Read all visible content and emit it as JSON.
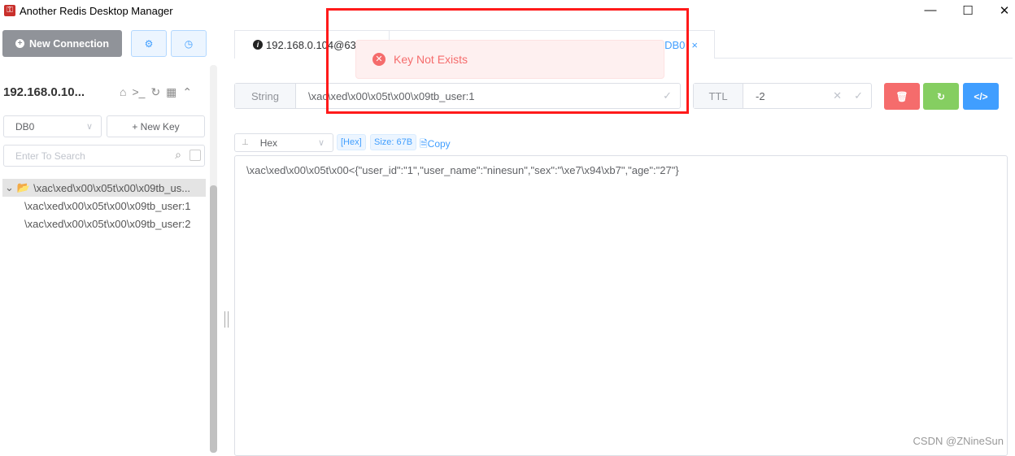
{
  "window": {
    "title": "Another Redis Desktop Manager",
    "controls": {
      "minimize": "—",
      "maximize": "☐",
      "close": "✕"
    }
  },
  "sidebar": {
    "new_connection_label": "New Connection",
    "connection_name": "192.168.0.10...",
    "db_select": "DB0",
    "new_key_label": "+ New Key",
    "search_placeholder": "Enter To Search",
    "tree": {
      "folder": "\\xac\\xed\\x00\\x05t\\x00\\x09tb_us...",
      "keys": [
        "\\xac\\xed\\x00\\x05t\\x00\\x09tb_user:1",
        "\\xac\\xed\\x00\\x05t\\x00\\x09tb_user:2"
      ]
    }
  },
  "tabs": [
    {
      "label": "192.168.0.104@63"
    },
    {
      "label": "DB0",
      "close": "×"
    }
  ],
  "key_bar": {
    "type": "String",
    "key_name": "\\xac\\xed\\x00\\x05t\\x00\\x09tb_user:1",
    "ttl_label": "TTL",
    "ttl_value": "-2"
  },
  "viewer": {
    "format": "Hex",
    "format_tag": "[Hex]",
    "size_tag": "Size: 67B",
    "copy_label": "Copy",
    "value": "\\xac\\xed\\x00\\x05t\\x00<{\"user_id\":\"1\",\"user_name\":\"ninesun\",\"sex\":\"\\xe7\\x94\\xb7\",\"age\":\"27\"}"
  },
  "toast": {
    "message": "Key Not Exists",
    "type": "error"
  },
  "watermark": "CSDN @ZNineSun",
  "colors": {
    "danger": "#f56c6c",
    "success": "#85ce61",
    "primary": "#409eff",
    "highlight": "#ff1a1a"
  }
}
